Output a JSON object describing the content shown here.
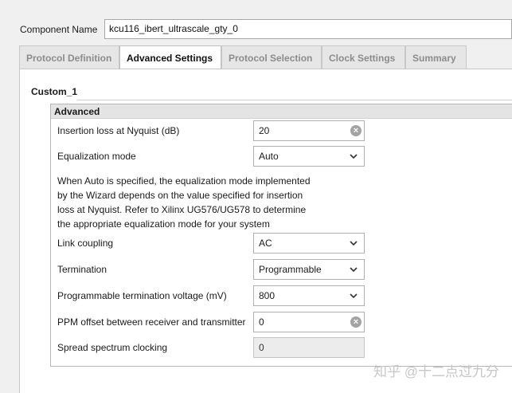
{
  "component": {
    "label": "Component Name",
    "value": "kcu116_ibert_ultrascale_gty_0"
  },
  "tabs": [
    {
      "label": "Protocol Definition",
      "active": false
    },
    {
      "label": "Advanced Settings",
      "active": true
    },
    {
      "label": "Protocol Selection",
      "active": false
    },
    {
      "label": "Clock Settings",
      "active": false
    },
    {
      "label": "Summary",
      "active": false
    }
  ],
  "section": {
    "title": "Custom_1",
    "group_title": "Advanced"
  },
  "fields": {
    "insertion_loss": {
      "label": "Insertion loss at Nyquist (dB)",
      "value": "20",
      "icon": "clear-icon"
    },
    "equalization": {
      "label": "Equalization mode",
      "value": "Auto",
      "icon": "chevron-down-icon"
    },
    "description": [
      "When Auto is specified, the equalization mode implemented",
      "by the Wizard depends on the value specified for insertion",
      "loss at Nyquist. Refer to Xilinx UG576/UG578 to determine",
      "the appropriate equalization mode for your system"
    ],
    "link_coupling": {
      "label": "Link coupling",
      "value": "AC",
      "icon": "chevron-down-icon"
    },
    "termination": {
      "label": "Termination",
      "value": "Programmable",
      "icon": "chevron-down-icon"
    },
    "term_voltage": {
      "label": "Programmable termination voltage (mV)",
      "value": "800",
      "icon": "chevron-down-icon"
    },
    "ppm_offset": {
      "label": "PPM offset between receiver and transmitter",
      "value": "0",
      "icon": "clear-icon"
    },
    "spread_spectrum": {
      "label": "Spread spectrum clocking",
      "value": "0",
      "disabled": true
    }
  },
  "watermark": "知乎 @十二点过九分"
}
